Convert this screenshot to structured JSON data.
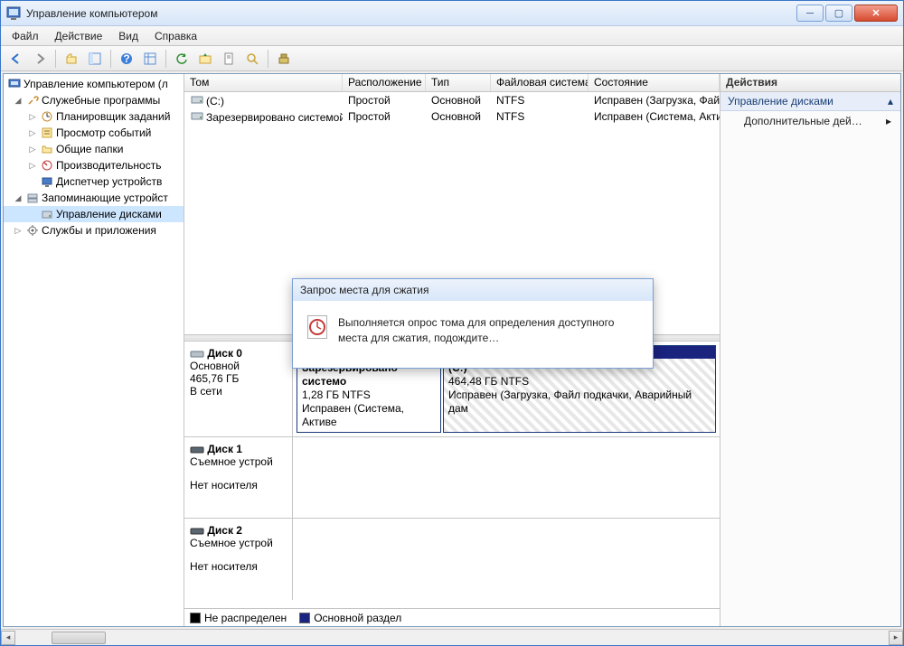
{
  "window": {
    "title": "Управление компьютером"
  },
  "menu": {
    "file": "Файл",
    "action": "Действие",
    "view": "Вид",
    "help": "Справка"
  },
  "tree": {
    "root": "Управление компьютером (л",
    "system_tools": "Служебные программы",
    "task_scheduler": "Планировщик заданий",
    "event_viewer": "Просмотр событий",
    "shared_folders": "Общие папки",
    "performance": "Производительность",
    "device_manager": "Диспетчер устройств",
    "storage": "Запоминающие устройст",
    "disk_mgmt": "Управление дисками",
    "services": "Службы и приложения"
  },
  "columns": {
    "volume": "Том",
    "layout": "Расположение",
    "type": "Тип",
    "fs": "Файловая система",
    "status": "Состояние"
  },
  "volumes": [
    {
      "name": "(C:)",
      "layout": "Простой",
      "type": "Основной",
      "fs": "NTFS",
      "status": "Исправен (Загрузка, Фай"
    },
    {
      "name": "Зарезервировано системой",
      "layout": "Простой",
      "type": "Основной",
      "fs": "NTFS",
      "status": "Исправен (Система, Акти"
    }
  ],
  "disks": {
    "d0": {
      "name": "Диск 0",
      "type": "Основной",
      "size": "465,76 ГБ",
      "status": "В сети",
      "p1": {
        "title": "Зарезервировано системо",
        "sizefs": "1,28 ГБ NTFS",
        "status": "Исправен (Система, Активе"
      },
      "p2": {
        "title": "(C:)",
        "sizefs": "464,48 ГБ NTFS",
        "status": "Исправен (Загрузка, Файл подкачки, Аварийный дам"
      }
    },
    "d1": {
      "name": "Диск 1",
      "type": "Съемное устрой",
      "nomedia": "Нет носителя"
    },
    "d2": {
      "name": "Диск 2",
      "type": "Съемное устрой",
      "nomedia": "Нет носителя"
    }
  },
  "legend": {
    "unallocated": "Не распределен",
    "primary": "Основной раздел"
  },
  "actions": {
    "header": "Действия",
    "section": "Управление дисками",
    "more": "Дополнительные дей…"
  },
  "dialog": {
    "title": "Запрос места для сжатия",
    "text": "Выполняется опрос тома для определения доступного места для сжатия, подождите…"
  }
}
